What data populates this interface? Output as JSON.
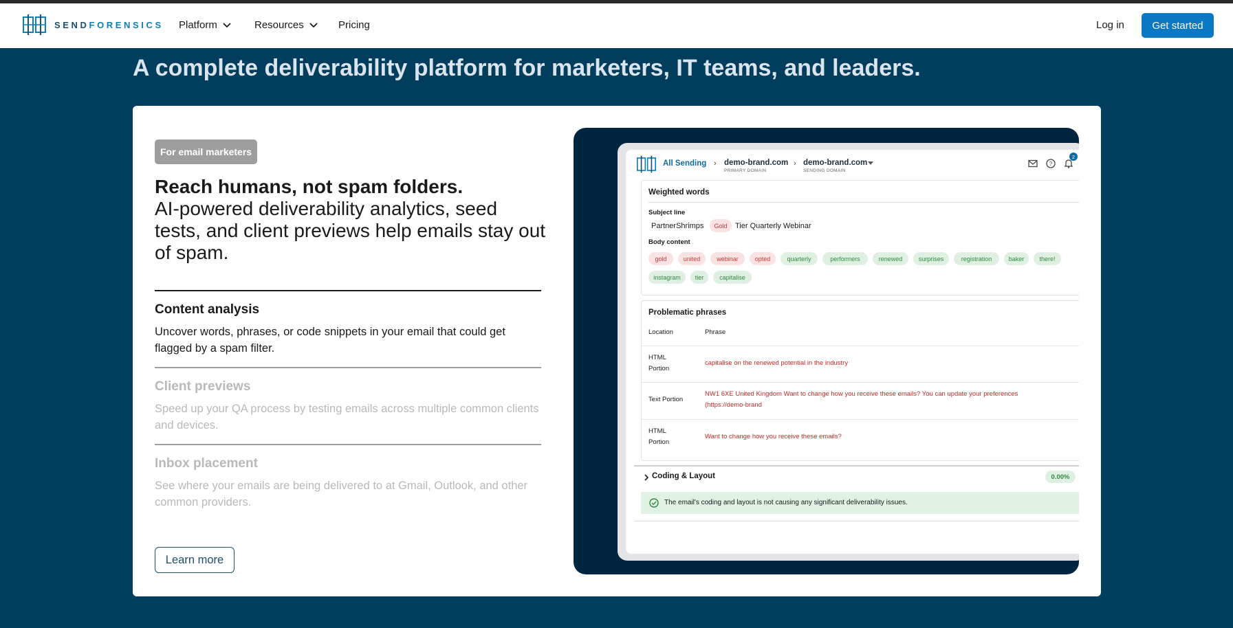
{
  "nav": {
    "brand_a": "SEND",
    "brand_b": "FORENSICS",
    "items": [
      {
        "label": "Platform",
        "icon": "chevron-down-icon"
      },
      {
        "label": "Resources",
        "icon": "chevron-down-icon"
      },
      {
        "label": "Pricing"
      }
    ],
    "login": "Log in",
    "cta": "Get started"
  },
  "hero": {
    "title": "A complete deliverability platform for marketers, IT teams, and leaders."
  },
  "card": {
    "badge": "For email marketers",
    "headline": "Reach humans, not spam folders.",
    "subline": "AI-powered deliverability analytics, seed tests, and client previews help emails stay out of spam.",
    "features": [
      {
        "title": "Content analysis",
        "desc": "Uncover words, phrases, or code snippets in your email that could get flagged by a spam filter.",
        "active": true
      },
      {
        "title": "Client previews",
        "desc": "Speed up your QA process by testing emails across multiple common clients and devices.",
        "active": false
      },
      {
        "title": "Inbox placement",
        "desc": "See where your emails are being delivered to at Gmail, Outlook, and other common providers.",
        "active": false
      }
    ],
    "learn_more": "Learn more"
  },
  "app": {
    "crumb_root": "All Sending",
    "crumb_1": "demo-brand.com",
    "crumb_1_sub": "PRIMARY DOMAIN",
    "crumb_2": "demo-brand.com",
    "crumb_2_sub": "SENDING DOMAIN",
    "notif_count": "2",
    "weighted": {
      "title": "Weighted words",
      "subject_label": "Subject line",
      "subject_a": "PartnerShrimps",
      "subject_chip": "Gold",
      "subject_b": "Tier Quarterly Webinar",
      "body_label": "Body content",
      "chips": [
        {
          "t": "gold",
          "c": "red"
        },
        {
          "t": "united",
          "c": "red"
        },
        {
          "t": "webinar",
          "c": "red"
        },
        {
          "t": "opted",
          "c": "red"
        },
        {
          "t": "quarterly",
          "c": "green"
        },
        {
          "t": "performers",
          "c": "green"
        },
        {
          "t": "renewed",
          "c": "green"
        },
        {
          "t": "surprises",
          "c": "green"
        },
        {
          "t": "registration",
          "c": "green"
        },
        {
          "t": "baker",
          "c": "green"
        },
        {
          "t": "there!",
          "c": "green"
        },
        {
          "t": "instagram",
          "c": "green"
        },
        {
          "t": "tier",
          "c": "green"
        },
        {
          "t": "capitalise",
          "c": "green"
        }
      ]
    },
    "phrases": {
      "title": "Problematic phrases",
      "col_location": "Location",
      "col_phrase": "Phrase",
      "rows": [
        {
          "loc1": "HTML",
          "loc2": "Portion",
          "phrase1": "capitalise on the renewed potential in the industry",
          "phrase2": ""
        },
        {
          "loc1": "Text Portion",
          "loc2": "",
          "phrase1": "NW1 6XE United Kingdom Want to change how you receive these emails? You can update your preferences",
          "phrase2": "(https://demo-brand"
        },
        {
          "loc1": "HTML",
          "loc2": "Portion",
          "phrase1": "Want to change how you receive these emails?",
          "phrase2": ""
        }
      ]
    },
    "coding": {
      "title": "Coding & Layout",
      "pct": "0.00%",
      "ok": "The email's coding and layout is not causing any significant deliverability issues."
    }
  },
  "colors": {
    "bg": "#013d5c",
    "accent": "#0a78c2",
    "panel": "#00263f",
    "danger": "#c62828",
    "success": "#2f8a42"
  }
}
